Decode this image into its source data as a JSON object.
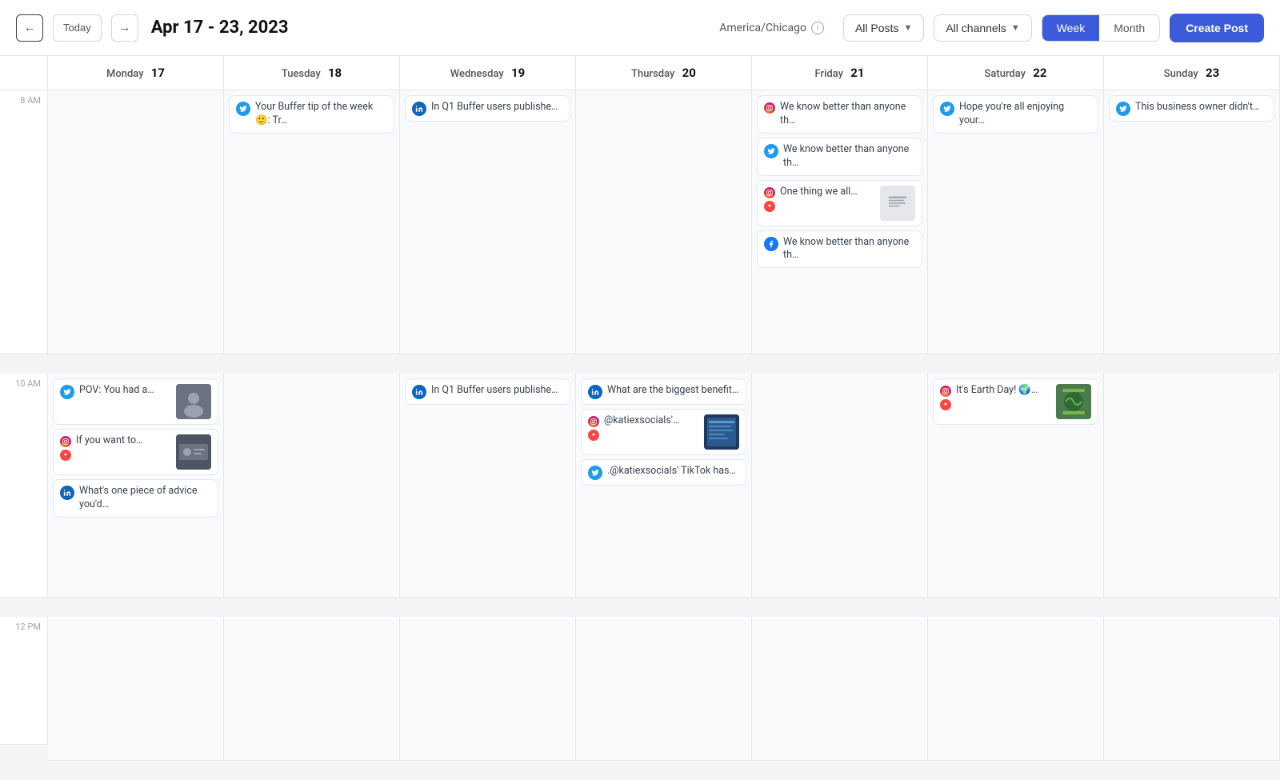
{
  "header": {
    "today_label": "Today",
    "date_range": "Apr 17 - 23, 2023",
    "timezone": "America/Chicago",
    "all_posts_label": "All Posts",
    "all_channels_label": "All channels",
    "week_label": "Week",
    "month_label": "Month",
    "create_post_label": "Create Post"
  },
  "days": [
    {
      "name": "Monday",
      "num": 17
    },
    {
      "name": "Tuesday",
      "num": 18
    },
    {
      "name": "Wednesday",
      "num": 19
    },
    {
      "name": "Thursday",
      "num": 20
    },
    {
      "name": "Friday",
      "num": 21
    },
    {
      "name": "Saturday",
      "num": 22
    },
    {
      "name": "Sunday",
      "num": 23
    }
  ],
  "time_slots": [
    "8 AM",
    "10 AM",
    "12 PM"
  ],
  "events": {
    "monday_8am": [],
    "tuesday_8am": [
      {
        "id": "t1",
        "type": "twitter",
        "text": "Your Buffer tip of the week 🙂: Tr…",
        "thumb": false
      }
    ],
    "wednesday_8am": [
      {
        "id": "w1",
        "type": "linkedin",
        "text": "In Q1 Buffer users publishe…",
        "thumb": false
      }
    ],
    "thursday_8am": [],
    "friday_8am": [
      {
        "id": "f1",
        "type": "instagram_facebook",
        "text": "We know better than anyone th…",
        "thumb": false
      },
      {
        "id": "f2",
        "type": "twitter",
        "text": "We know better than anyone th…",
        "thumb": false
      },
      {
        "id": "f3",
        "type": "instagram_stacked",
        "text": "One thing we all…",
        "thumb": true
      },
      {
        "id": "f4",
        "type": "facebook",
        "text": "We know better than anyone th…",
        "thumb": false
      }
    ],
    "saturday_8am": [
      {
        "id": "s1",
        "type": "twitter",
        "text": "Hope you're all enjoying your…",
        "thumb": false
      }
    ],
    "sunday_8am": [
      {
        "id": "su1",
        "type": "twitter",
        "text": "This business owner didn't…",
        "thumb": false
      }
    ],
    "monday_10am": [
      {
        "id": "m1",
        "type": "twitter",
        "text": "POV: You had a…",
        "thumb": true
      },
      {
        "id": "m2",
        "type": "instagram_stacked2",
        "text": "If you want to…",
        "thumb": true
      },
      {
        "id": "m3",
        "type": "linkedin",
        "text": "What's one piece of advice you'd…",
        "thumb": false
      }
    ],
    "tuesday_10am": [],
    "wednesday_10am": [
      {
        "id": "w2",
        "type": "linkedin",
        "text": "In Q1 Buffer users publishe…",
        "thumb": false
      }
    ],
    "thursday_10am": [
      {
        "id": "th1",
        "type": "linkedin",
        "text": "What are the biggest benefit…",
        "thumb": false
      },
      {
        "id": "th2",
        "type": "instagram_stacked3",
        "text": "@katiexsocials'…",
        "thumb": true
      },
      {
        "id": "th3",
        "type": "twitter",
        "text": ".@katiexsocials' TikTok has…",
        "thumb": false
      }
    ],
    "friday_10am": [],
    "saturday_10am": [
      {
        "id": "sat1",
        "type": "instagram_stacked4",
        "text": "It's Earth Day! 🌍…",
        "thumb": true
      }
    ],
    "sunday_10am": []
  },
  "colors": {
    "twitter": "#1d9bf0",
    "linkedin": "#0a66c2",
    "instagram": "#e1306c",
    "facebook": "#1877f2",
    "accent": "#3b5bdb"
  }
}
